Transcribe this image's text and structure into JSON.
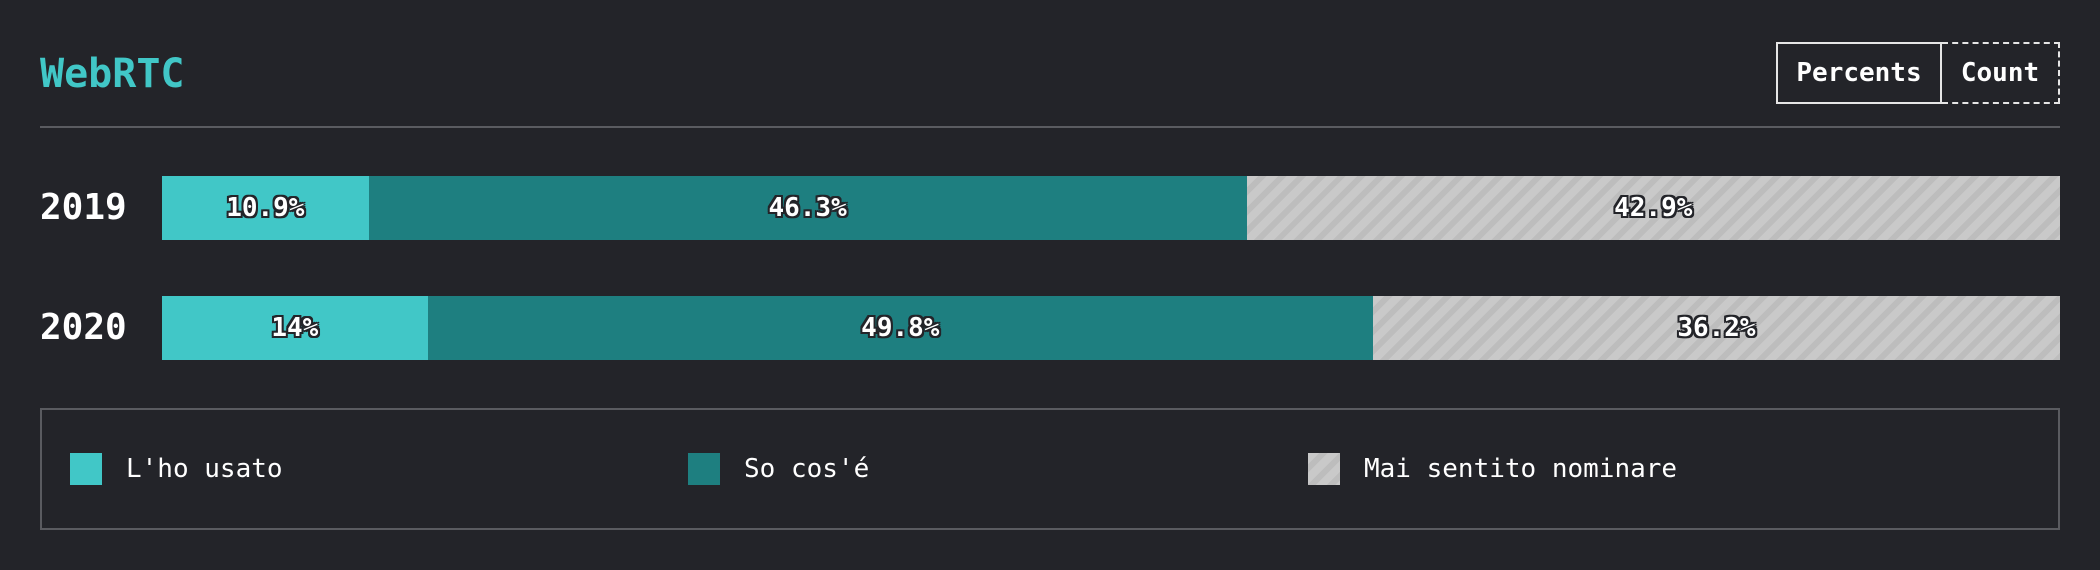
{
  "header": {
    "title": "WebRTC"
  },
  "toggle": {
    "percents_label": "Percents",
    "count_label": "Count"
  },
  "chart_data": {
    "type": "bar",
    "orientation": "horizontal",
    "stacked": true,
    "normalized": true,
    "categories": [
      "2019",
      "2020"
    ],
    "series": [
      {
        "name": "L'ho usato",
        "values": [
          10.9,
          14
        ],
        "labels": [
          "10.9%",
          "14%"
        ],
        "color": "#41c7c7"
      },
      {
        "name": "So cos'é",
        "values": [
          46.3,
          49.8
        ],
        "labels": [
          "46.3%",
          "49.8%"
        ],
        "color": "#1e7f80"
      },
      {
        "name": "Mai sentito nominare",
        "values": [
          42.9,
          36.2
        ],
        "labels": [
          "42.9%",
          "36.2%"
        ],
        "color": "#c9c9c9"
      }
    ],
    "legend_position": "bottom",
    "active_mode": "Percents"
  }
}
